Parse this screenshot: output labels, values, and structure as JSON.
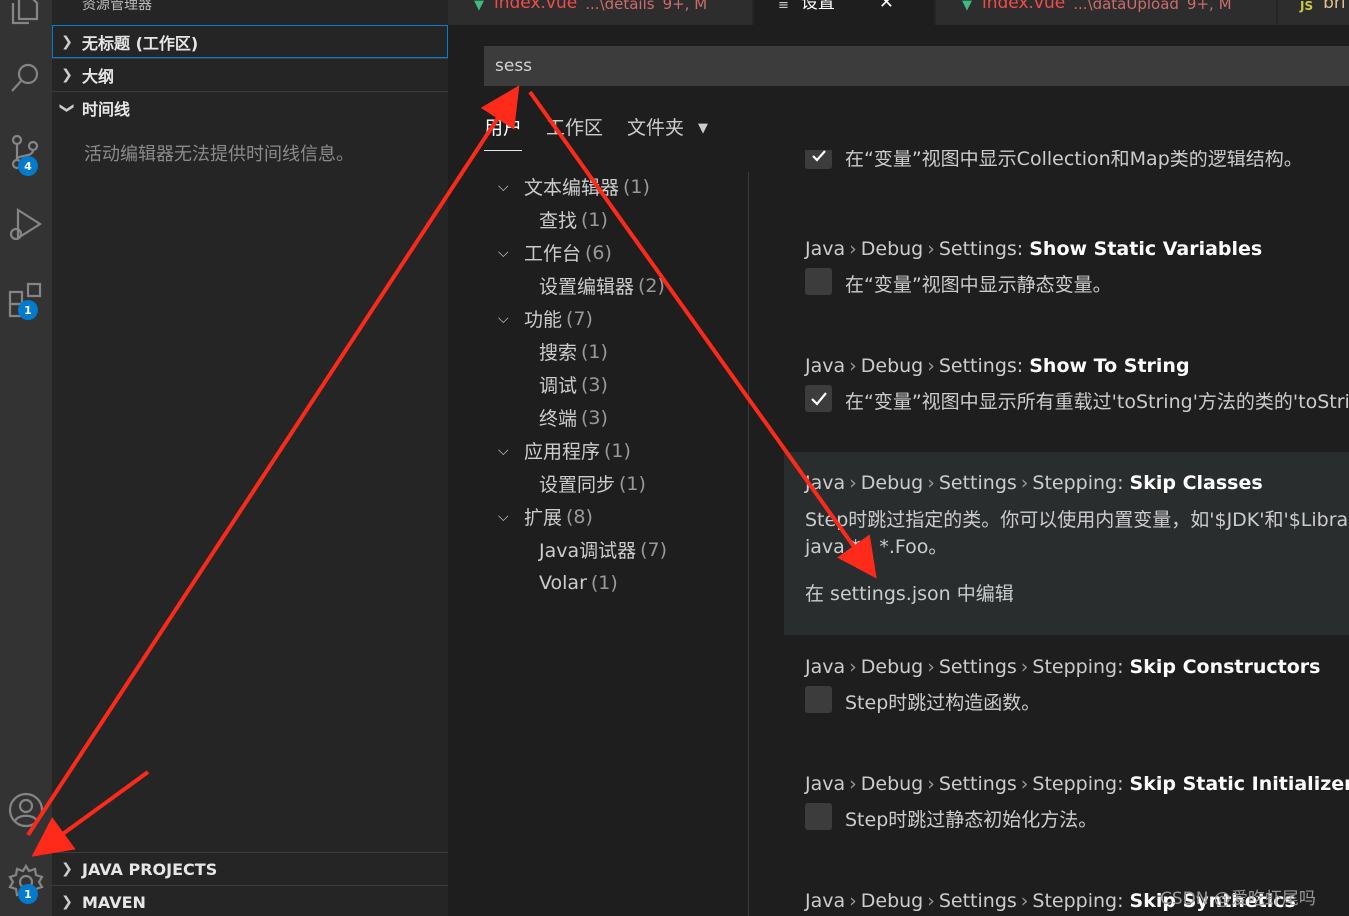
{
  "activity_bar": {
    "source_control_badge": "4",
    "extensions_badge": "1",
    "manage_badge": "1"
  },
  "sidebar": {
    "header": "资源管理器",
    "header_more": "···",
    "sections": {
      "untitled_workspace": "无标题 (工作区)",
      "outline": "大纲",
      "timeline": "时间线",
      "java_projects": "JAVA PROJECTS",
      "maven": "MAVEN"
    },
    "timeline_message": "活动编辑器无法提供时间线信息。"
  },
  "tabs": [
    {
      "name": "index.vue",
      "path": "...\\details",
      "status": "9+, M"
    },
    {
      "name": "设置",
      "close": "✕"
    },
    {
      "name": "index.vue",
      "path": "...\\dataUpload",
      "status": "9+, M"
    },
    {
      "name": "bri",
      "lang": "JS"
    }
  ],
  "search": {
    "value": "sess"
  },
  "scope_tabs": {
    "user": "用户",
    "workspace": "工作区",
    "folder": "文件夹"
  },
  "toc": [
    {
      "label": "文本编辑器",
      "count": "(1)",
      "level": 0
    },
    {
      "label": "查找",
      "count": "(1)",
      "level": 1
    },
    {
      "label": "工作台",
      "count": "(6)",
      "level": 0
    },
    {
      "label": "设置编辑器",
      "count": "(2)",
      "level": 1
    },
    {
      "label": "功能",
      "count": "(7)",
      "level": 0
    },
    {
      "label": "搜索",
      "count": "(1)",
      "level": 1
    },
    {
      "label": "调试",
      "count": "(3)",
      "level": 1
    },
    {
      "label": "终端",
      "count": "(3)",
      "level": 1
    },
    {
      "label": "应用程序",
      "count": "(1)",
      "level": 0
    },
    {
      "label": "设置同步",
      "count": "(1)",
      "level": 1
    },
    {
      "label": "扩展",
      "count": "(8)",
      "level": 0
    },
    {
      "label": "Java调试器",
      "count": "(7)",
      "level": 1
    },
    {
      "label": "Volar",
      "count": "(1)",
      "level": 1
    }
  ],
  "settings": {
    "partial_top_desc": "在“变量”视图中显示Collection和Map类的逻辑结构。",
    "show_static_variables": {
      "prefix": [
        "Java",
        "Debug",
        "Settings"
      ],
      "key": "Show Static Variables",
      "desc": "在“变量”视图中显示静态变量。",
      "checked": false
    },
    "show_to_string": {
      "prefix": [
        "Java",
        "Debug",
        "Settings"
      ],
      "key": "Show To String",
      "desc": "在“变量”视图中显示所有重载过'toString'方法的类的'toString'值。",
      "checked": true
    },
    "skip_classes": {
      "prefix": [
        "Java",
        "Debug",
        "Settings",
        "Stepping"
      ],
      "key": "Skip Classes",
      "desc_line1": "Step时跳过指定的类。你可以使用内置变量，如'$JDK'和'$Libraries'来跳过一组类，或者添加特定的类名表达式，例如java.*，*.Foo。",
      "desc_line2": "java.*，*.Foo。",
      "edit_link": "在 settings.json 中编辑"
    },
    "skip_constructors": {
      "prefix": [
        "Java",
        "Debug",
        "Settings",
        "Stepping"
      ],
      "key": "Skip Constructors",
      "desc": "Step时跳过构造函数。",
      "checked": false
    },
    "skip_static_initializers": {
      "prefix": [
        "Java",
        "Debug",
        "Settings",
        "Stepping"
      ],
      "key": "Skip Static Initializers",
      "desc": "Step时跳过静态初始化方法。",
      "checked": false
    },
    "skip_synthetics": {
      "prefix": [
        "Java",
        "Debug",
        "Settings",
        "Stepping"
      ],
      "key": "Skip Synthetics"
    }
  },
  "watermark": "CSDN @爱吃虾尾吗",
  "colors": {
    "activity_bar": "#333333",
    "sidebar": "#252526",
    "editor": "#1e1e1e",
    "accent": "#007acc",
    "annotation_arrow": "#ff2a1a",
    "modified_tab": "#f14c4c"
  }
}
